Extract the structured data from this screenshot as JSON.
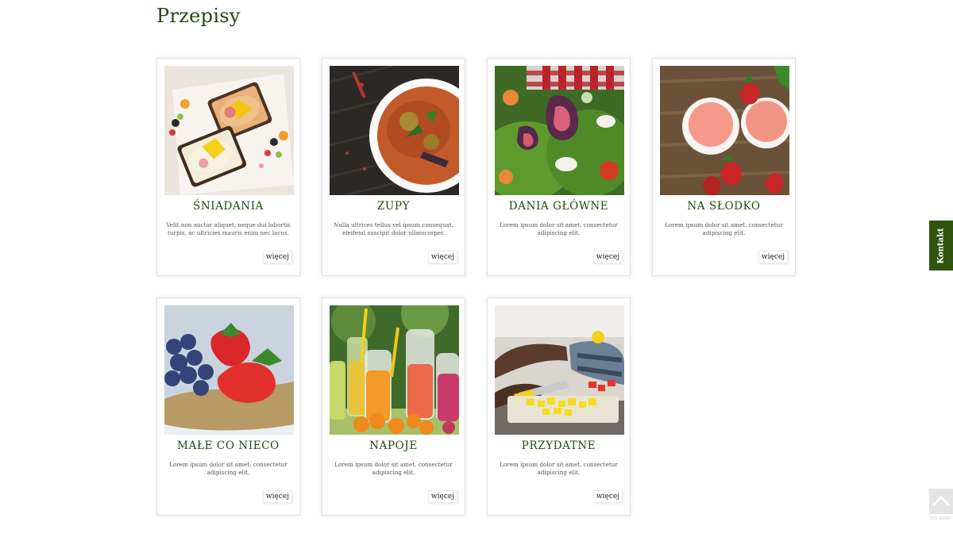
{
  "page": {
    "title": "Przepisy"
  },
  "cards": [
    {
      "title": "ŚNIADANIA",
      "description": "Velit non auctor aliquet, neque dui lobortis turpis, ac ultricies mauris enim nec lacus.",
      "more_label": "więcej",
      "image": "breakfast-sandwiches-image"
    },
    {
      "title": "ZUPY",
      "description": "Nulla ultrices tellus vel ipsum consequat, eleifend suscipit dolor ullamcorper.",
      "more_label": "więcej",
      "image": "soup-bowl-image"
    },
    {
      "title": "DANIA GŁÓWNE",
      "description": "Lorem ipsum dolor sit amet, consectetur adipiscing elit.",
      "more_label": "więcej",
      "image": "fig-salad-image"
    },
    {
      "title": "NA SŁODKO",
      "description": "Lorem ipsum dolor sit amet, consectetur adipiscing elit.",
      "more_label": "więcej",
      "image": "ice-cream-strawberries-image"
    },
    {
      "title": "MAŁE CO NIECO",
      "description": "Lorem ipsum dolor sit amet, consectetur adipiscing elit.",
      "more_label": "więcej",
      "image": "strawberries-blueberries-image"
    },
    {
      "title": "NAPOJE",
      "description": "Lorem ipsum dolor sit amet, consectetur adipiscing elit.",
      "more_label": "więcej",
      "image": "juice-bottles-image"
    },
    {
      "title": "PRZYDATNE",
      "description": "Lorem ipsum dolor sit amet, consectetur adipiscing elit.",
      "more_label": "więcej",
      "image": "cutting-peppers-image"
    }
  ],
  "contact_tab": {
    "label": "Kontakt"
  },
  "back_to_top": {
    "label": "DO GÓRY",
    "icon": "chevron-up-icon"
  },
  "colors": {
    "accent_green": "#2f5410",
    "title_green": "#1f4a0f"
  }
}
